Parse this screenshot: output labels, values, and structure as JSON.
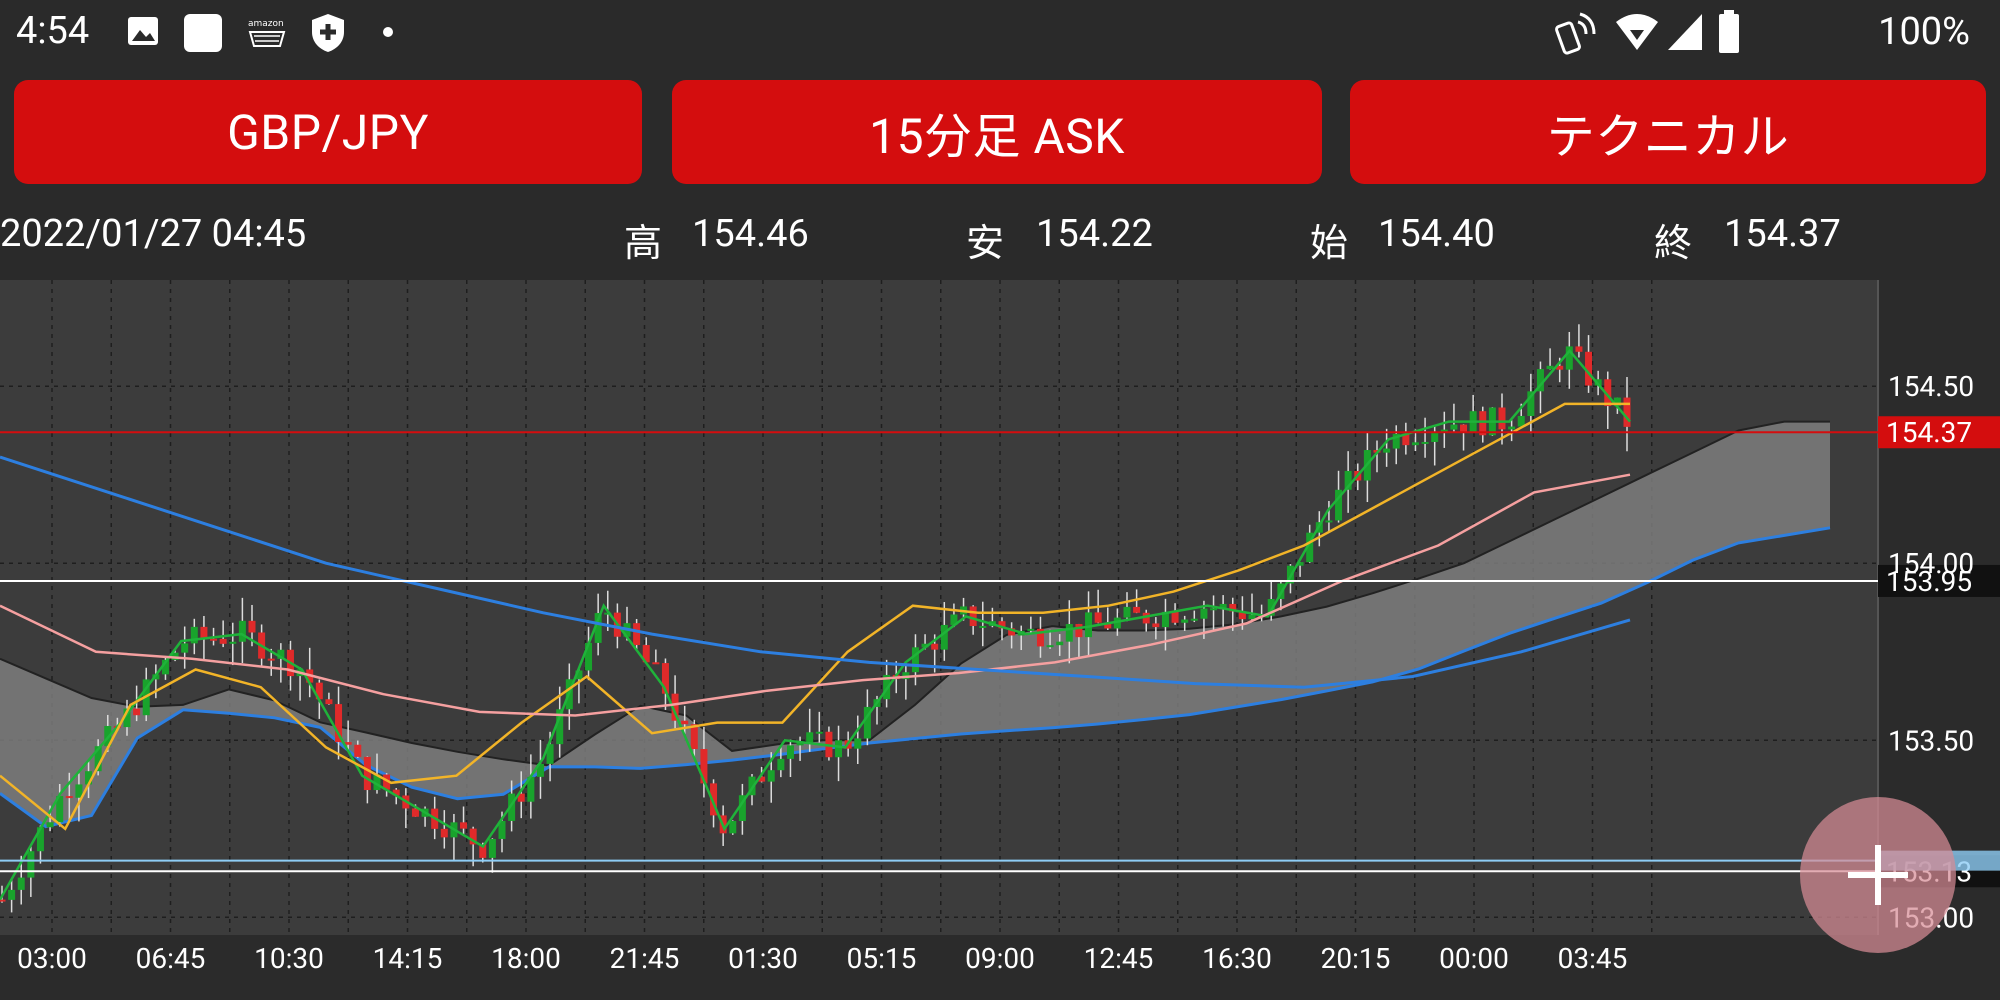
{
  "status_bar": {
    "time": "4:54",
    "icons": [
      "image-icon",
      "square-app-icon",
      "amazon-icon",
      "shield-plus-icon",
      "dot-icon",
      "nfc-icon",
      "wifi-icon",
      "signal-icon",
      "battery-icon"
    ],
    "battery": "100%"
  },
  "toolbar": {
    "pair": "GBP/JPY",
    "timeframe": "15分足 ASK",
    "technical": "テクニカル"
  },
  "info": {
    "datetime": "2022/01/27 04:45",
    "high_label": "高",
    "high_value": "154.46",
    "low_label": "安",
    "low_value": "154.22",
    "open_label": "始",
    "open_value": "154.40",
    "close_label": "終",
    "close_value": "154.37"
  },
  "chart_data": {
    "type": "line",
    "xlabel": "",
    "ylabel": "",
    "x_ticks": [
      "03:00",
      "06:45",
      "10:30",
      "14:15",
      "18:00",
      "21:45",
      "01:30",
      "05:15",
      "09:00",
      "12:45",
      "16:30",
      "20:15",
      "00:00",
      "03:45"
    ],
    "y_ticks": [
      "154.50",
      "154.00",
      "153.50",
      "153.00"
    ],
    "ylim": [
      152.95,
      154.8
    ],
    "current_price": "154.37",
    "current_price_color": "#d40d0e",
    "horizontal_lines": [
      {
        "value": 153.95,
        "label": "153.95",
        "color": "#ffffff"
      },
      {
        "value": 153.13,
        "label": "153.13",
        "color": "#ffffff"
      },
      {
        "value": 153.16,
        "label": "",
        "color": "#8ecdf5"
      }
    ],
    "series": [
      {
        "values": [
          153.05,
          153.35,
          153.55,
          153.78,
          153.8,
          153.7,
          153.4,
          153.3,
          153.2,
          153.45,
          153.88,
          153.65,
          153.25,
          153.5,
          153.48,
          153.72,
          153.85,
          153.8,
          153.82,
          153.85,
          153.88,
          153.85,
          154.15,
          154.35,
          154.4,
          154.4,
          154.6,
          154.4
        ]
      },
      {
        "values": [
          153.4,
          153.25,
          153.6,
          153.7,
          153.65,
          153.48,
          153.38,
          153.4,
          153.55,
          153.68,
          153.52,
          153.55,
          153.55,
          153.75,
          153.88,
          153.86,
          153.86,
          153.88,
          153.92,
          153.98,
          154.05,
          154.15,
          154.25,
          154.35,
          154.45,
          154.45
        ]
      },
      {
        "values": [
          153.88,
          153.75,
          153.73,
          153.7,
          153.63,
          153.58,
          153.57,
          153.6,
          153.64,
          153.67,
          153.69,
          153.72,
          153.77,
          153.83,
          153.95,
          154.05,
          154.2,
          154.25
        ]
      },
      {
        "values": [
          154.3,
          154.2,
          154.1,
          154.0,
          153.93,
          153.86,
          153.8,
          153.75,
          153.72,
          153.7,
          153.68,
          153.66,
          153.65,
          153.68,
          153.75,
          153.84
        ]
      }
    ],
    "colors": {
      "up": "#19a32c",
      "down": "#e02a2a",
      "fast_ma": "#1fb33a",
      "mid_ma": "#f2b428",
      "slow_ma": "#f5a0a0",
      "long_ma": "#2d7fe0",
      "cloud": "#7d7d7d"
    }
  }
}
